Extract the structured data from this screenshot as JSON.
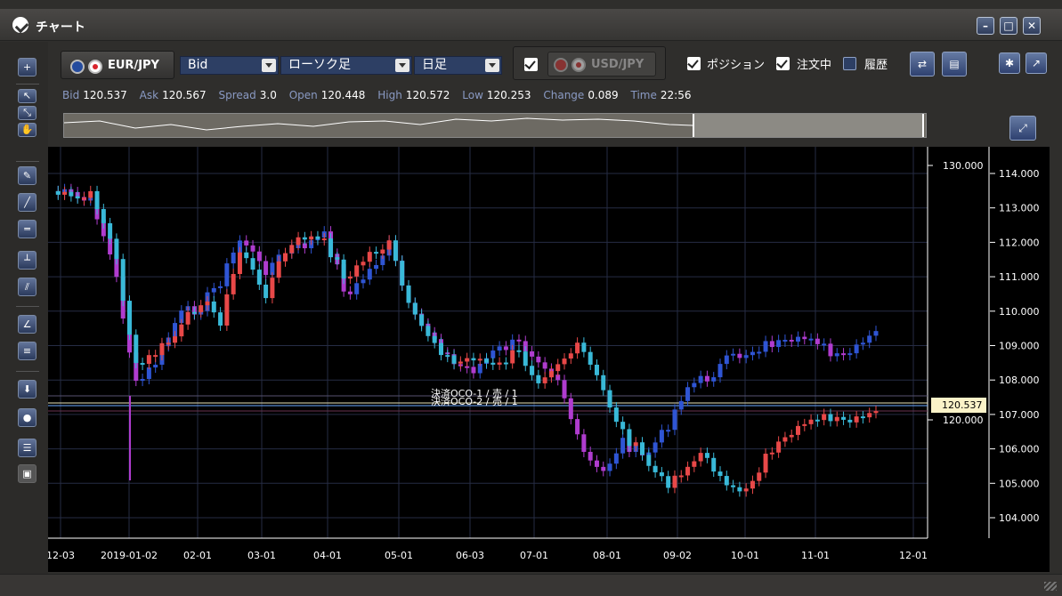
{
  "window": {
    "title": "チャート",
    "minimize": "–",
    "maximize": "□",
    "close": "✕"
  },
  "toolbar": {
    "symbol": "EUR/JPY",
    "price_type": "Bid",
    "chart_type": "ローソク足",
    "timeframe": "日足",
    "compare_symbol": "USD/JPY",
    "compare_checked": true,
    "position_label": "ポジション",
    "order_label": "注文中",
    "history_label": "履歴"
  },
  "info": {
    "bid_label": "Bid",
    "bid": "120.537",
    "ask_label": "Ask",
    "ask": "120.567",
    "spread_label": "Spread",
    "spread": "3.0",
    "open_label": "Open",
    "open": "120.448",
    "high_label": "High",
    "high": "120.572",
    "low_label": "Low",
    "low": "120.253",
    "change_label": "Change",
    "change": "0.089",
    "time_label": "Time",
    "time": "22:56"
  },
  "chart_data": {
    "type": "candlestick",
    "x_ticks": [
      "12-03",
      "2019-01-02",
      "02-01",
      "03-01",
      "04-01",
      "05-01",
      "06-03",
      "07-01",
      "08-01",
      "09-02",
      "10-01",
      "11-01",
      "12-01"
    ],
    "left_axis": {
      "ticks": [
        "130.000",
        "120.000"
      ]
    },
    "right_axis": {
      "ticks": [
        "114.000",
        "113.000",
        "112.000",
        "111.000",
        "110.000",
        "109.000",
        "108.000",
        "107.000",
        "106.000",
        "105.000",
        "104.000"
      ],
      "range": [
        103.5,
        114.5
      ]
    },
    "current_price": "120.537",
    "order_lines": [
      "決済OCO-1 / 売 / 1",
      "決済OCO-2 / 売 / 1"
    ],
    "series": [
      {
        "name": "EUR/JPY",
        "colors": {
          "up": "#e84848",
          "down": "#39b9d8"
        }
      },
      {
        "name": "USD/JPY",
        "colors": {
          "up": "#2f55d4",
          "down": "#b03ccf"
        }
      }
    ]
  }
}
